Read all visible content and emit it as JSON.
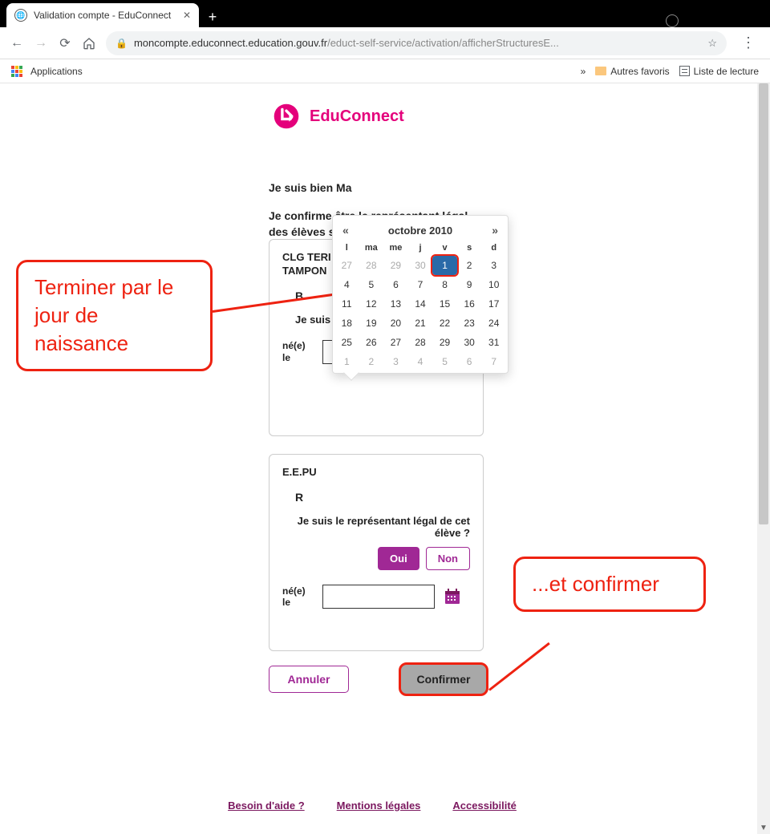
{
  "window": {
    "title": "Validation compte - EduConnect",
    "controls": {
      "minimize": "—",
      "maximize": "▢",
      "close": "✕"
    },
    "newtab": "+",
    "dot": "●"
  },
  "nav": {
    "back": "←",
    "forward": "→",
    "reload": "⟳",
    "url_prefix": "moncompte.educonnect.education.gouv.fr",
    "url_rest": "/educt-self-service/activation/afficherStructuresE...",
    "star": "☆",
    "menu": "⋮"
  },
  "bookmarks": {
    "apps": "Applications",
    "more": "»",
    "other": "Autres favoris",
    "read": "Liste de lecture"
  },
  "brand": "EduConnect",
  "intro": {
    "line1": "Je suis bien Ma",
    "line2": "Je confirme être le représentant légal des élèves s"
  },
  "card1": {
    "school": "CLG TERI\nTAMPON",
    "child": "B",
    "question": "Je suis",
    "dob": "né(e) le"
  },
  "card2": {
    "school": "E.E.PU",
    "child": "R",
    "question": "Je suis le représentant légal de cet élève ?",
    "dob": "né(e) le"
  },
  "buttons": {
    "oui": "Oui",
    "non": "Non",
    "cancel": "Annuler",
    "confirm": "Confirmer"
  },
  "datepicker": {
    "prev": "«",
    "next": "»",
    "title": "octobre 2010",
    "dow": [
      "l",
      "ma",
      "me",
      "j",
      "v",
      "s",
      "d"
    ],
    "weeks": [
      [
        {
          "d": "27",
          "o": 1
        },
        {
          "d": "28",
          "o": 1
        },
        {
          "d": "29",
          "o": 1
        },
        {
          "d": "30",
          "o": 1
        },
        {
          "d": "1",
          "sel": 1
        },
        {
          "d": "2"
        },
        {
          "d": "3"
        }
      ],
      [
        {
          "d": "4"
        },
        {
          "d": "5"
        },
        {
          "d": "6"
        },
        {
          "d": "7"
        },
        {
          "d": "8"
        },
        {
          "d": "9"
        },
        {
          "d": "10"
        }
      ],
      [
        {
          "d": "11"
        },
        {
          "d": "12"
        },
        {
          "d": "13"
        },
        {
          "d": "14"
        },
        {
          "d": "15"
        },
        {
          "d": "16"
        },
        {
          "d": "17"
        }
      ],
      [
        {
          "d": "18"
        },
        {
          "d": "19"
        },
        {
          "d": "20"
        },
        {
          "d": "21"
        },
        {
          "d": "22"
        },
        {
          "d": "23"
        },
        {
          "d": "24"
        }
      ],
      [
        {
          "d": "25"
        },
        {
          "d": "26"
        },
        {
          "d": "27"
        },
        {
          "d": "28"
        },
        {
          "d": "29"
        },
        {
          "d": "30"
        },
        {
          "d": "31"
        }
      ],
      [
        {
          "d": "1",
          "o": 1
        },
        {
          "d": "2",
          "o": 1
        },
        {
          "d": "3",
          "o": 1
        },
        {
          "d": "4",
          "o": 1
        },
        {
          "d": "5",
          "o": 1
        },
        {
          "d": "6",
          "o": 1
        },
        {
          "d": "7",
          "o": 1
        }
      ]
    ]
  },
  "footer": {
    "help": "Besoin d'aide ?",
    "legal": "Mentions légales",
    "access": "Accessibilité"
  },
  "callouts": {
    "c1": "Terminer par le jour de naissance",
    "c2": "...et confirmer"
  },
  "colors": {
    "accent": "#e4007b",
    "purple": "#a02895",
    "annot": "#e21"
  }
}
